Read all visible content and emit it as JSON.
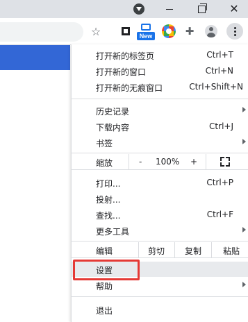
{
  "window": {
    "close_glyph": "✕"
  },
  "toolbar": {
    "star_glyph": "☆",
    "puzzle_glyph": "✚",
    "new_badge": "New"
  },
  "menu": {
    "items": [
      {
        "label": "打开新的标签页",
        "shortcut": "Ctrl+T"
      },
      {
        "label": "打开新的窗口",
        "shortcut": "Ctrl+N"
      },
      {
        "label": "打开新的无痕窗口",
        "shortcut": "Ctrl+Shift+N"
      },
      {
        "label": "历史记录",
        "shortcut": ""
      },
      {
        "label": "下载内容",
        "shortcut": "Ctrl+J"
      },
      {
        "label": "书签",
        "shortcut": ""
      },
      {
        "label": "打印...",
        "shortcut": "Ctrl+P"
      },
      {
        "label": "投射...",
        "shortcut": ""
      },
      {
        "label": "查找...",
        "shortcut": "Ctrl+F"
      },
      {
        "label": "更多工具",
        "shortcut": ""
      },
      {
        "label": "设置",
        "shortcut": ""
      },
      {
        "label": "帮助",
        "shortcut": ""
      },
      {
        "label": "退出",
        "shortcut": ""
      }
    ],
    "zoom": {
      "label": "缩放",
      "minus": "-",
      "value": "100%",
      "plus": "+"
    },
    "edit": {
      "label": "编辑",
      "cut": "剪切",
      "copy": "复制",
      "paste": "粘贴"
    }
  },
  "colors": {
    "accent": "#1a73e8",
    "highlight_border": "#e53935",
    "page_bar": "#3367d6"
  }
}
